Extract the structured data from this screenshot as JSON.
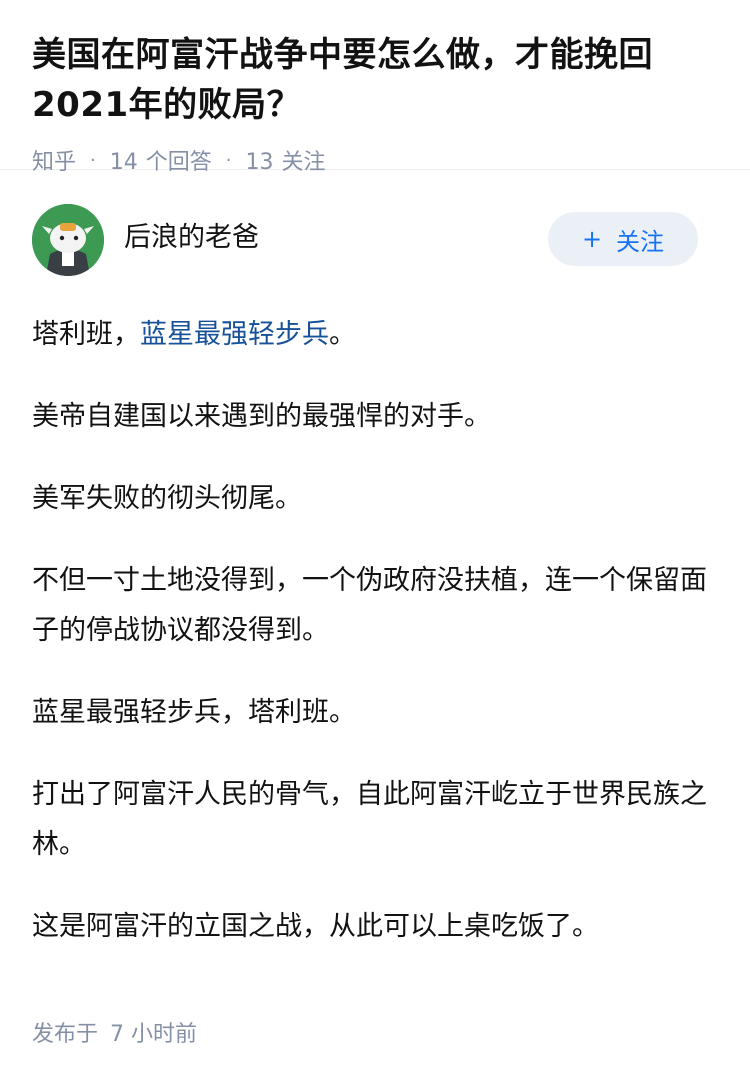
{
  "question": {
    "title": "美国在阿富汗战争中要怎么做，才能挽回2021年的败局？",
    "source": "知乎",
    "answers_count": "14",
    "answers_label": "个回答",
    "followers_count": "13",
    "followers_label": "关注"
  },
  "author": {
    "name": "后浪的老爸",
    "avatar_icon": "cartoon-avatar-icon",
    "follow_label": "关注",
    "follow_icon": "plus-icon"
  },
  "answer": {
    "p1_text": "塔利班，",
    "p1_link": "蓝星最强轻步兵",
    "p1_end": "。",
    "p2": "美帝自建国以来遇到的最强悍的对手。",
    "p3": "美军失败的彻头彻尾。",
    "p4": "不但一寸土地没得到，一个伪政府没扶植，连一个保留面子的停战协议都没得到。",
    "p5": "蓝星最强轻步兵，塔利班。",
    "p6": "打出了阿富汗人民的骨气，自此阿富汗屹立于世界民族之林。",
    "p7": "这是阿富汗的立国之战，从此可以上桌吃饭了。"
  },
  "footer": {
    "published_label": "发布于",
    "published_time": "7 小时前"
  },
  "colors": {
    "link": "#175199",
    "meta": "#8590a6",
    "follow_bg": "#ebf0f7",
    "follow_text": "#1772f6",
    "avatar_bg": "#3d9a52"
  }
}
